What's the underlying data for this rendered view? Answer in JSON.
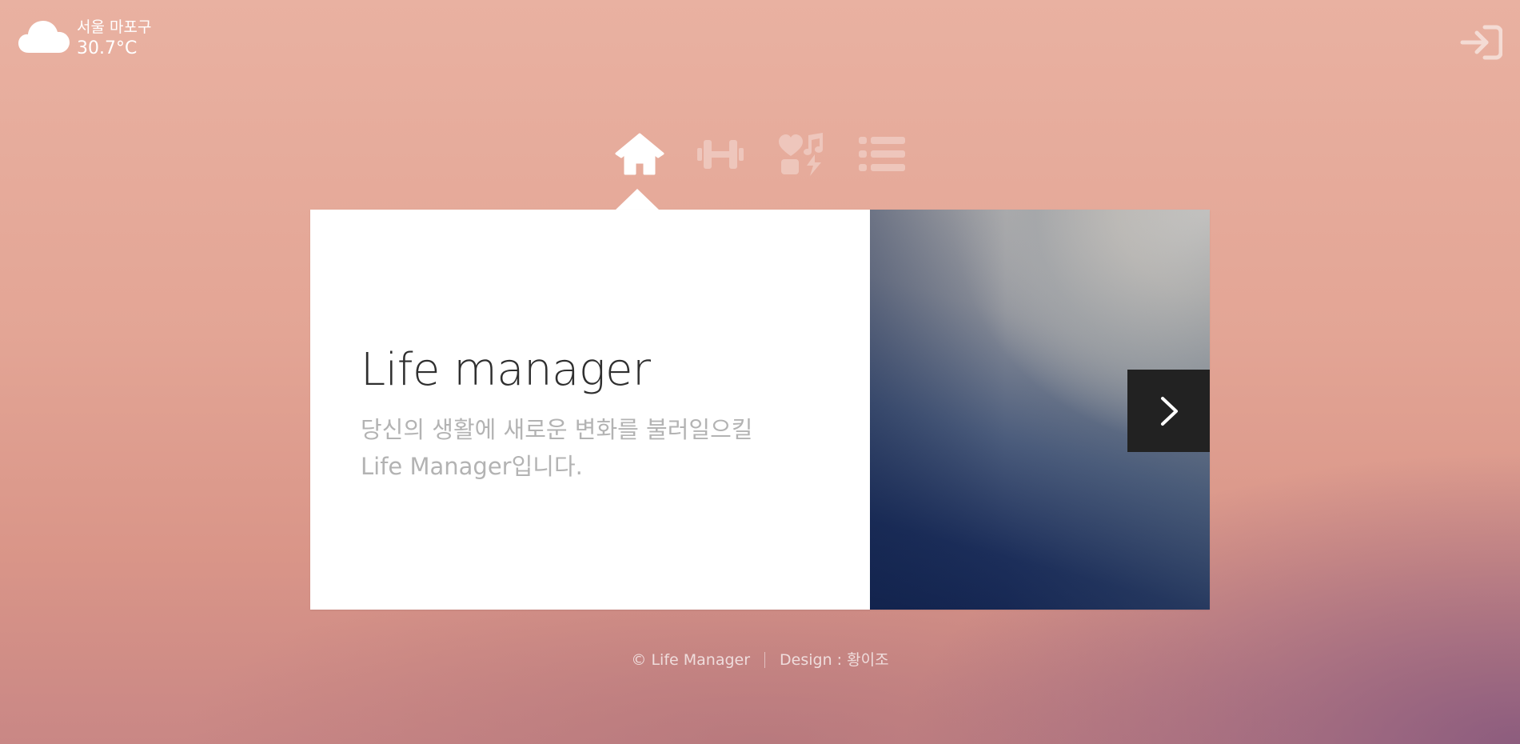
{
  "weather": {
    "icon": "cloud-icon",
    "location": "서울 마포구",
    "temperature": "30.7°C"
  },
  "header": {
    "login_icon": "sign-in-icon"
  },
  "nav": {
    "items": [
      {
        "icon": "home-icon",
        "active": true
      },
      {
        "icon": "dumbbell-icon",
        "active": false
      },
      {
        "icon": "heart-music-icon",
        "active": false
      },
      {
        "icon": "list-icon",
        "active": false
      }
    ]
  },
  "card": {
    "title": "Life manager",
    "description_line1": "당신의 생활에 새로운 변화를 불러일으킬",
    "description_line2": "Life Manager입니다.",
    "next_icon": "chevron-right-icon"
  },
  "footer": {
    "copyright": "© Life Manager",
    "design": "Design : 황이조"
  },
  "colors": {
    "background_top": "#e9b1a1",
    "background_bottom_right": "#82557d",
    "card_bg": "#ffffff",
    "title_text": "#2f2f2f",
    "desc_text": "#b3b3b3",
    "next_button": "#222222"
  }
}
